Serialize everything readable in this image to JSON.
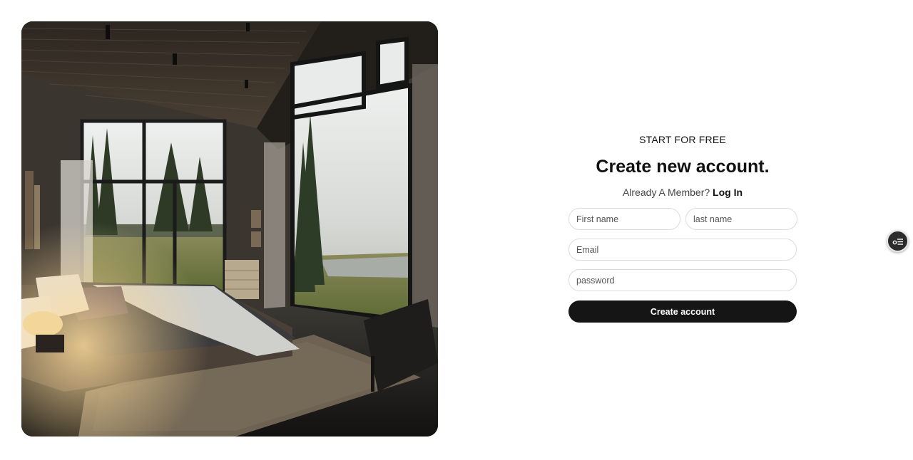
{
  "hero": {
    "image_icon": "bedroom-photo"
  },
  "form": {
    "eyebrow": "START FOR FREE",
    "title": "Create new account.",
    "member_prompt": "Already A Member?",
    "login_link": "Log In",
    "first_name_placeholder": "First name",
    "last_name_placeholder": "last name",
    "email_placeholder": "Email",
    "password_placeholder": "password",
    "submit_label": "Create account"
  },
  "widget": {
    "icon": "settings-list-icon"
  },
  "colors": {
    "button_bg": "#151515",
    "input_border": "#dcdcdc",
    "widget_bg": "#2b2b2b"
  }
}
